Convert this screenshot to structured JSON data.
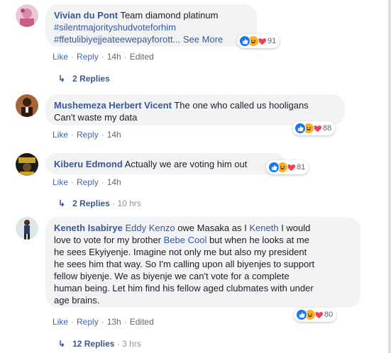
{
  "comments": [
    {
      "author": "Vivian du Pont",
      "lines": [
        "Team diamond platinum"
      ],
      "hashtags": [
        "#silentmajorityshudvoteforhim",
        "#ffetulibiyejjeateewepayforott..."
      ],
      "see_more": "See More",
      "reaction_count": "91",
      "actions": {
        "like": "Like",
        "reply": "Reply",
        "time": "14h",
        "edited": "Edited"
      },
      "replies": {
        "label": "2 Replies",
        "time": ""
      }
    },
    {
      "author": "Mushemeza Herbert Vicent",
      "text_first": "The one who called us hooligans",
      "text_second": "Can't waste my data",
      "reaction_count": "88",
      "actions": {
        "like": "Like",
        "reply": "Reply",
        "time": "14h"
      }
    },
    {
      "author": "Kiberu Edmond",
      "text": "Actually we are voting him out",
      "reaction_count": "81",
      "actions": {
        "like": "Like",
        "reply": "Reply",
        "time": "14h"
      },
      "replies": {
        "label": "2 Replies",
        "time": "10 hrs"
      }
    },
    {
      "author": "Keneth Isabirye",
      "tag1": "Eddy Kenzo",
      "t1": "owe Masaka as I",
      "tag2": "Keneth",
      "t2": "I would",
      "t3": "love to vote for my brother",
      "tag3": "Bebe Cool",
      "t4": "but when he looks at me",
      "rest": [
        "he sees Ekyiyenje. Imagine not only me but also my president",
        "he sees him that way. So I'm calling upon all biyenjes to support",
        "fellow biyenje. We as biyenje we can't vote for a complete",
        "human being. Let him find his fellow aged clubmates with under",
        "age brains."
      ],
      "reaction_count": "80",
      "actions": {
        "like": "Like",
        "reply": "Reply",
        "time": "13h",
        "edited": "Edited"
      },
      "replies": {
        "label": "12 Replies",
        "time": "3 hrs"
      }
    }
  ],
  "colors": {
    "link": "#385898",
    "bubble": "#f2f3f5",
    "like": "#1877f2",
    "haha": "#f7b125",
    "love": "#f33e58"
  }
}
